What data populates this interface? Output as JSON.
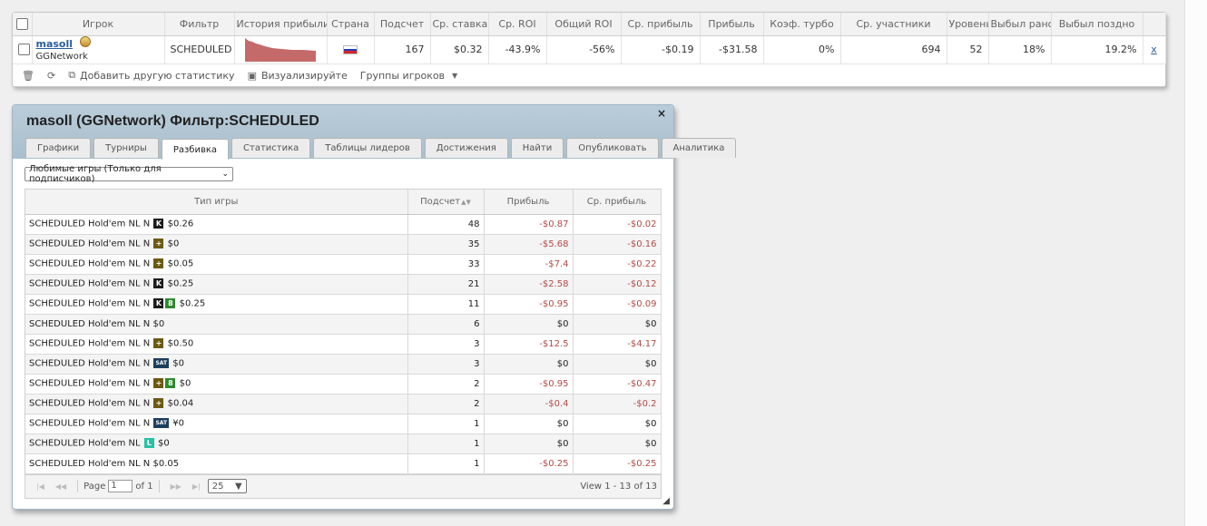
{
  "top": {
    "headers": [
      "Игрок",
      "Фильтр",
      "История прибыли",
      "Страна",
      "Подсчет",
      "Ср. ставка",
      "Ср. ROI",
      "Общий ROI",
      "Ср. прибыль",
      "Прибыль",
      "Коэф. турбо",
      "Ср. участники",
      "Уровень",
      "Выбыл рано",
      "Выбыл поздно"
    ],
    "row": {
      "player_name": "masoll",
      "player_network": "GGNetwork",
      "filter": "SCHEDULED",
      "count": "167",
      "avg_stake": "$0.32",
      "avg_roi": "-43.9%",
      "total_roi": "-56%",
      "avg_profit": "-$0.19",
      "profit": "-$31.58",
      "turbo": "0%",
      "avg_entrants": "694",
      "level": "52",
      "early_out": "18%",
      "late_out": "19.2%",
      "remove": "x"
    },
    "toolbar": {
      "add_stat": "Добавить другую статистику",
      "visualize": "Визуализируйте",
      "groups": "Группы игроков"
    },
    "flag_colors": [
      "#ffffff",
      "#1c3fb8",
      "#d8232a"
    ],
    "graph_color": "#c56a6a"
  },
  "dialog": {
    "title": "masoll (GGNetwork) Фильтр:SCHEDULED",
    "close": "×",
    "tabs": [
      "Графики",
      "Турниры",
      "Разбивка",
      "Статистика",
      "Таблицы лидеров",
      "Достижения",
      "Найти",
      "Опубликовать",
      "Аналитика"
    ],
    "active_tab": "Разбивка",
    "dropdown": "Любимые игры (Только для подписчиков)",
    "columns": [
      "Тип игры",
      "Подсчет",
      "Прибыль",
      "Ср. прибыль"
    ],
    "rows": [
      {
        "prefix": "SCHEDULED Hold'em NL N",
        "badges": [
          "K"
        ],
        "suffix": "$0.26",
        "count": "48",
        "profit": "-$0.87",
        "avg": "-$0.02"
      },
      {
        "prefix": "SCHEDULED Hold'em NL N",
        "badges": [
          "+"
        ],
        "suffix": "$0",
        "count": "35",
        "profit": "-$5.68",
        "avg": "-$0.16"
      },
      {
        "prefix": "SCHEDULED Hold'em NL N",
        "badges": [
          "+"
        ],
        "suffix": "$0.05",
        "count": "33",
        "profit": "-$7.4",
        "avg": "-$0.22"
      },
      {
        "prefix": "SCHEDULED Hold'em NL N",
        "badges": [
          "K"
        ],
        "suffix": "$0.25",
        "count": "21",
        "profit": "-$2.58",
        "avg": "-$0.12"
      },
      {
        "prefix": "SCHEDULED Hold'em NL N",
        "badges": [
          "K",
          "8"
        ],
        "suffix": "$0.25",
        "count": "11",
        "profit": "-$0.95",
        "avg": "-$0.09"
      },
      {
        "prefix": "SCHEDULED Hold'em NL N",
        "badges": [],
        "suffix": "$0",
        "count": "6",
        "profit": "$0",
        "avg": "$0"
      },
      {
        "prefix": "SCHEDULED Hold'em NL N",
        "badges": [
          "+"
        ],
        "suffix": "$0.50",
        "count": "3",
        "profit": "-$12.5",
        "avg": "-$4.17"
      },
      {
        "prefix": "SCHEDULED Hold'em NL N",
        "badges": [
          "SAT"
        ],
        "suffix": "$0",
        "count": "3",
        "profit": "$0",
        "avg": "$0"
      },
      {
        "prefix": "SCHEDULED Hold'em NL N",
        "badges": [
          "+",
          "8"
        ],
        "suffix": "$0",
        "count": "2",
        "profit": "-$0.95",
        "avg": "-$0.47"
      },
      {
        "prefix": "SCHEDULED Hold'em NL N",
        "badges": [
          "+"
        ],
        "suffix": "$0.04",
        "count": "2",
        "profit": "-$0.4",
        "avg": "-$0.2"
      },
      {
        "prefix": "SCHEDULED Hold'em NL N",
        "badges": [
          "SAT"
        ],
        "suffix": "¥0",
        "count": "1",
        "profit": "$0",
        "avg": "$0"
      },
      {
        "prefix": "SCHEDULED Hold'em NL",
        "badges": [
          "L"
        ],
        "suffix": "$0",
        "count": "1",
        "profit": "$0",
        "avg": "$0"
      },
      {
        "prefix": "SCHEDULED Hold'em NL N",
        "badges": [],
        "suffix": "$0.05",
        "count": "1",
        "profit": "-$0.25",
        "avg": "-$0.25"
      }
    ],
    "pager": {
      "page_label": "Page",
      "page_value": "1",
      "of_label": "of 1",
      "per_page": "25",
      "view": "View 1 - 13 of 13"
    }
  }
}
